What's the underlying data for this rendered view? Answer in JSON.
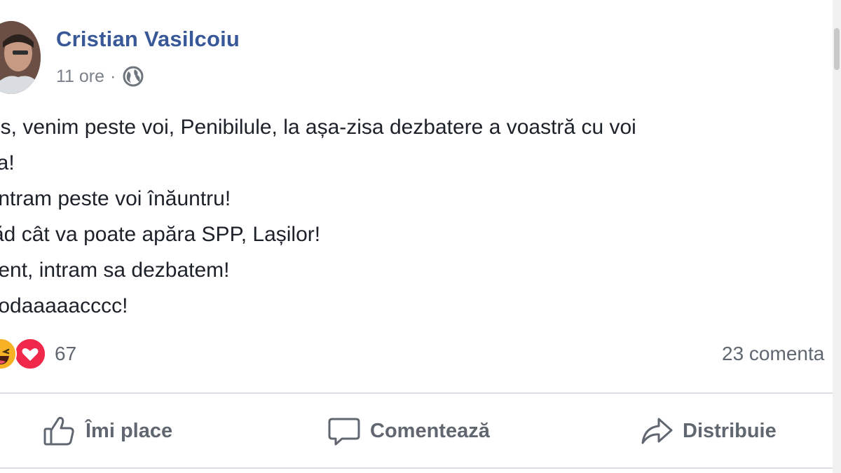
{
  "post": {
    "author": "Cristian Vasilcoiu",
    "time": "11 ore",
    "separator": "·",
    "privacy_icon": "globe-icon",
    "text_lines": [
      "res, venim peste voi, Penibilule, la așa-zisa dezbatere a voastră cu voi",
      "iva!",
      ", intram peste voi înăuntru!",
      " văd cât va poate apăra SPP, Lașilor!",
      "ident, intram sa dezbatem!",
      "tcodaaaaacccc!"
    ]
  },
  "reactions": {
    "icons": [
      "haha-icon",
      "love-icon"
    ],
    "count": "67",
    "comments": "23 comenta"
  },
  "actions": {
    "like": "Îmi place",
    "comment": "Comentează",
    "share": "Distribuie"
  },
  "colors": {
    "author": "#385898",
    "meta": "#7b818a",
    "text": "#1d2129",
    "action": "#606770",
    "haha": "#f7b125",
    "love": "#f0284a"
  }
}
